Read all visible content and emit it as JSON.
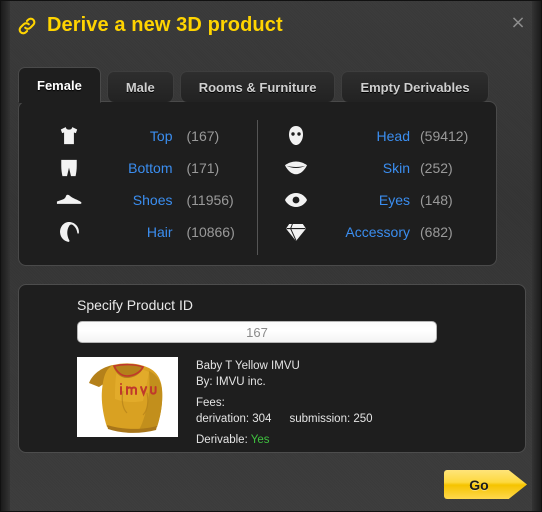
{
  "window": {
    "title": "Derive a new 3D product",
    "title_icon": "chain-link-icon",
    "title_color": "#ffd400",
    "close_label": "×"
  },
  "tabs": [
    {
      "label": "Female",
      "active": true
    },
    {
      "label": "Male",
      "active": false
    },
    {
      "label": "Rooms & Furniture",
      "active": false
    },
    {
      "label": "Empty Derivables",
      "active": false
    }
  ],
  "categories": {
    "left": [
      {
        "icon": "tshirt-icon",
        "label": "Top",
        "count": "(167)"
      },
      {
        "icon": "shorts-icon",
        "label": "Bottom",
        "count": "(171)"
      },
      {
        "icon": "shoe-icon",
        "label": "Shoes",
        "count": "(11956)"
      },
      {
        "icon": "hair-icon",
        "label": "Hair",
        "count": "(10866)"
      }
    ],
    "right": [
      {
        "icon": "head-icon",
        "label": "Head",
        "count": "(59412)"
      },
      {
        "icon": "lips-icon",
        "label": "Skin",
        "count": "(252)"
      },
      {
        "icon": "eye-icon",
        "label": "Eyes",
        "count": "(148)"
      },
      {
        "icon": "gem-icon",
        "label": "Accessory",
        "count": "(682)"
      }
    ]
  },
  "product": {
    "specify_label": "Specify Product ID",
    "product_id_value": "167",
    "product_id_placeholder": "167",
    "name": "Baby T Yellow IMVU",
    "author": "By: IMVU inc.",
    "fees_label": "Fees:",
    "fee_derivation": "derivation: 304",
    "fee_submission": "submission: 250",
    "derivable_label": "Derivable:",
    "derivable_value": "Yes",
    "derivable_color": "#3fc13f",
    "thumbnail_alt": "yellow imvu baby t-shirt on torso"
  },
  "actions": {
    "go_label": "Go"
  },
  "colors": {
    "accent_yellow": "#ffd400",
    "link_blue": "#3b8ef0",
    "count_gray": "#9a9a9a",
    "panel_bg": "#1e1e1e",
    "window_bg": "#3a3a3a"
  }
}
